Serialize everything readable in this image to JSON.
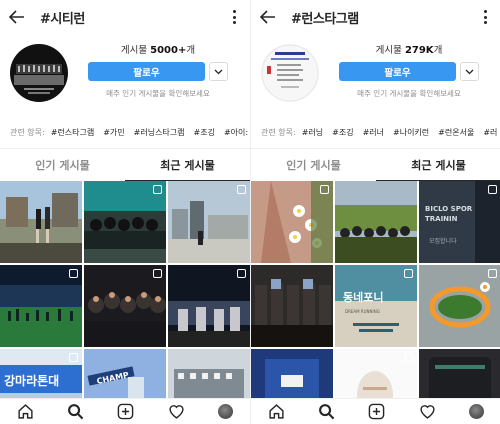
{
  "screens": [
    {
      "hashtag": "#시티런",
      "posts_label": "게시물",
      "posts_count": "5000+",
      "posts_unit": "개",
      "follow_label": "팔로우",
      "subtitle": "매주 인기 게시물을 확인해보세요",
      "related_label": "관련 항목:",
      "related_tags": [
        "#런스타그램",
        "#가민",
        "#러닝스타그램",
        "#조깅",
        "#아이:"
      ],
      "tabs": [
        "인기 게시물",
        "최근 게시물"
      ],
      "active_tab": 1,
      "tiles": [
        {
          "colors": [
            "#a7c4dc",
            "#7a7f66",
            "#4c4a3f"
          ]
        },
        {
          "colors": [
            "#34544d",
            "#1f8c8e",
            "#2b3b3a"
          ]
        },
        {
          "colors": [
            "#b6c7d5",
            "#5f6b70",
            "#c9c9c1"
          ]
        },
        {
          "colors": [
            "#0e1b2e",
            "#1d3656",
            "#2a7a3b"
          ]
        },
        {
          "colors": [
            "#1b1b1f",
            "#3a3430",
            "#17161a"
          ]
        },
        {
          "colors": [
            "#101522",
            "#39455c",
            "#c8c8cc"
          ]
        },
        {
          "colors": [
            "#dfe9f2",
            "#2d6fd1",
            "#b6ccdf"
          ]
        },
        {
          "colors": [
            "#8fb1e2",
            "#d9e4ef",
            "#1f3f7a"
          ]
        },
        {
          "colors": [
            "#cfd6db",
            "#7f8a93",
            "#f1f1f1"
          ]
        }
      ],
      "banner_text": "강마라톤대",
      "tile_text": "CHAMP"
    },
    {
      "hashtag": "#런스타그램",
      "posts_label": "게시물",
      "posts_count": "279K",
      "posts_unit": "개",
      "follow_label": "팔로우",
      "subtitle": "매주 인기 게시물을 확인해보세요",
      "related_label": "관련 항목:",
      "related_tags": [
        "#러닝",
        "#조깅",
        "#러너",
        "#나이키런",
        "#런온서울",
        "#러"
      ],
      "tabs": [
        "인기 게시물",
        "최근 게시물"
      ],
      "active_tab": 1,
      "tiles": [
        {
          "colors": [
            "#c59a86",
            "#e7e5d9",
            "#5c7b3f"
          ]
        },
        {
          "colors": [
            "#6d8f3f",
            "#a8b9c8",
            "#3d4d22"
          ]
        },
        {
          "colors": [
            "#2f3a46",
            "#1c232c",
            "#d8dde2"
          ]
        },
        {
          "colors": [
            "#2d2a2a",
            "#3b3533",
            "#16120f"
          ]
        },
        {
          "colors": [
            "#4f8fa1",
            "#d7d0c0",
            "#2c5f6f"
          ]
        },
        {
          "colors": [
            "#9aa3a3",
            "#3c7a2d",
            "#f39a2b"
          ]
        },
        {
          "colors": [
            "#1f3a7a",
            "#f2f2f2",
            "#2b55a8"
          ]
        },
        {
          "colors": [
            "#e9dfd4",
            "#caa88e",
            "#fafafa"
          ]
        },
        {
          "colors": [
            "#2a2a2e",
            "#1d1e22",
            "#3f7c6a"
          ]
        }
      ],
      "tile_texts": {
        "dream": "동네포니",
        "dream_sub": "DREAM RUNNING",
        "biclo": "BICLO SPOR",
        "biclo2": "TRAININ",
        "biclo3": "모집합니다"
      }
    }
  ]
}
